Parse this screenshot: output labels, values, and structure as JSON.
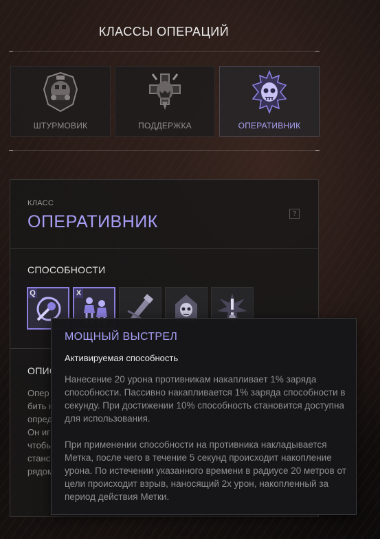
{
  "header": {
    "title": "КЛАССЫ ОПЕРАЦИЙ"
  },
  "class_tabs": [
    {
      "label": "ШТУРМОВИК",
      "icon": "assault-emblem-icon",
      "active": false
    },
    {
      "label": "ПОДДЕРЖКА",
      "icon": "support-emblem-icon",
      "active": false
    },
    {
      "label": "ОПЕРАТИВНИК",
      "icon": "operative-emblem-icon",
      "active": true
    }
  ],
  "class_panel": {
    "caption": "КЛАСС",
    "name": "ОПЕРАТИВНИК",
    "help_label": "?"
  },
  "abilities": {
    "heading": "СПОСОБНОСТИ",
    "items": [
      {
        "key": "Q",
        "icon": "power-shot-icon",
        "highlighted": true
      },
      {
        "key": "X",
        "icon": "squad-icon",
        "highlighted": true
      },
      {
        "key": "",
        "icon": "melee-weapon-icon",
        "highlighted": false
      },
      {
        "key": "",
        "icon": "hooded-skull-icon",
        "highlighted": false
      },
      {
        "key": "",
        "icon": "alert-burst-icon",
        "highlighted": false
      }
    ]
  },
  "description": {
    "heading": "ОПИС",
    "lines": [
      "Опер",
      "бить н",
      "опред",
      "Он иг",
      "чтобы",
      "станс",
      "рядом"
    ]
  },
  "tooltip": {
    "title": "МОЩНЫЙ ВЫСТРЕЛ",
    "type": "Активируемая способность",
    "paragraph1": "Нанесение 20 урона противникам накапливает 1% заряда способности. Пассивно накапливается 1% заряда способности в секунду. При достижении 10% способность становится доступна для использования.",
    "paragraph2": "При применении способности на противника накладывается Метка, после чего в течение 5 секунд происходит накопление урона. По истечении указанного времени в радиусе 20 метров от цели происходит взрыв, наносящий 2х урон, накопленный за период действия Метки."
  },
  "colors": {
    "accent": "#a79ef5",
    "ability_highlight": "#8b7fe0",
    "key_badge": "#3d3868"
  }
}
